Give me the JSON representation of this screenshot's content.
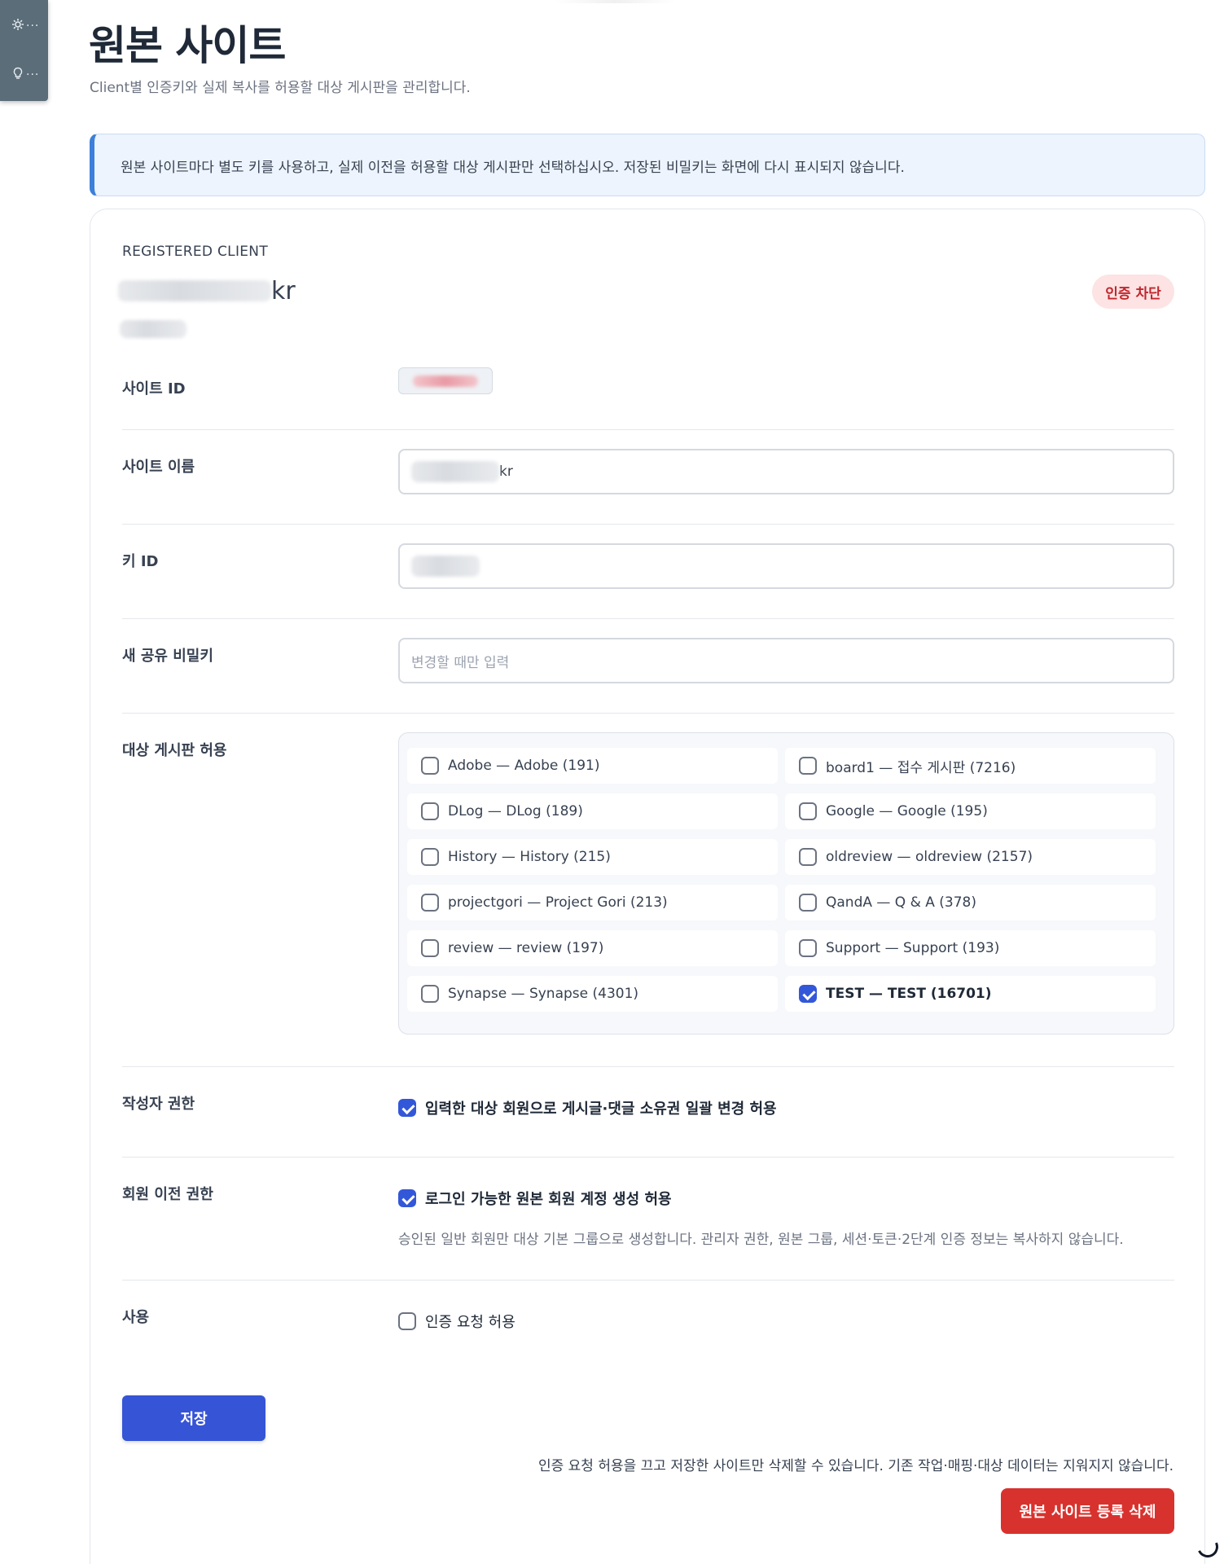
{
  "header": {
    "title": "원본 사이트",
    "subtitle": "Client별 인증키와 실제 복사를 허용할 대상 게시판을 관리합니다."
  },
  "side_tools": [
    {
      "icon": "gear-icon",
      "dots": "···"
    },
    {
      "icon": "lightbulb-icon",
      "dots": "···"
    }
  ],
  "notice": {
    "text": "원본 사이트마다 별도 키를 사용하고, 실제 이전을 허용할 대상 게시판만 선택하십시오. 저장된 비밀키는 화면에 다시 표시되지 않습니다."
  },
  "client": {
    "eyebrow": "REGISTERED CLIENT",
    "name_suffix": "kr",
    "status_badge": "인증 차단",
    "status_color": "#c0272d"
  },
  "fields": {
    "site_id_label": "사이트 ID",
    "site_name_label": "사이트 이름",
    "site_name_suffix": "kr",
    "key_id_label": "키 ID",
    "secret_label": "새 공유 비밀키",
    "secret_placeholder": "변경할 때만 입력",
    "boards_label": "대상 게시판 허용"
  },
  "boards": [
    {
      "label": "Adobe — Adobe (191)",
      "checked": false
    },
    {
      "label": "board1 — 접수 게시판 (7216)",
      "checked": false
    },
    {
      "label": "DLog — DLog (189)",
      "checked": false
    },
    {
      "label": "Google — Google (195)",
      "checked": false
    },
    {
      "label": "History — History (215)",
      "checked": false
    },
    {
      "label": "oldreview — oldreview (2157)",
      "checked": false
    },
    {
      "label": "projectgori — Project Gori (213)",
      "checked": false
    },
    {
      "label": "QandA — Q & A (378)",
      "checked": false
    },
    {
      "label": "review — review (197)",
      "checked": false
    },
    {
      "label": "Support — Support (193)",
      "checked": false
    },
    {
      "label": "Synapse — Synapse (4301)",
      "checked": false
    },
    {
      "label": "TEST — TEST (16701)",
      "checked": true
    }
  ],
  "author": {
    "label": "작성자 권한",
    "option": "입력한 대상 회원으로 게시글·댓글 소유권 일괄 변경 허용",
    "checked": true
  },
  "member": {
    "label": "회원 이전 권한",
    "option": "로그인 가능한 원본 회원 계정 생성 허용",
    "checked": true,
    "help": "승인된 일반 회원만 대상 기본 그룹으로 생성합니다. 관리자 권한, 원본 그룹, 세션·토큰·2단계 인증 정보는 복사하지 않습니다."
  },
  "usage": {
    "label": "사용",
    "option": "인증 요청 허용",
    "checked": false
  },
  "actions": {
    "save_label": "저장",
    "delete_note": "인증 요청 허용을 끄고 저장한 사이트만 삭제할 수 있습니다. 기존 작업·매핑·대상 데이터는 지워지지 않습니다.",
    "delete_label": "원본 사이트 등록 삭제",
    "primary_color": "#3654d6",
    "danger_color": "#d8322e"
  }
}
